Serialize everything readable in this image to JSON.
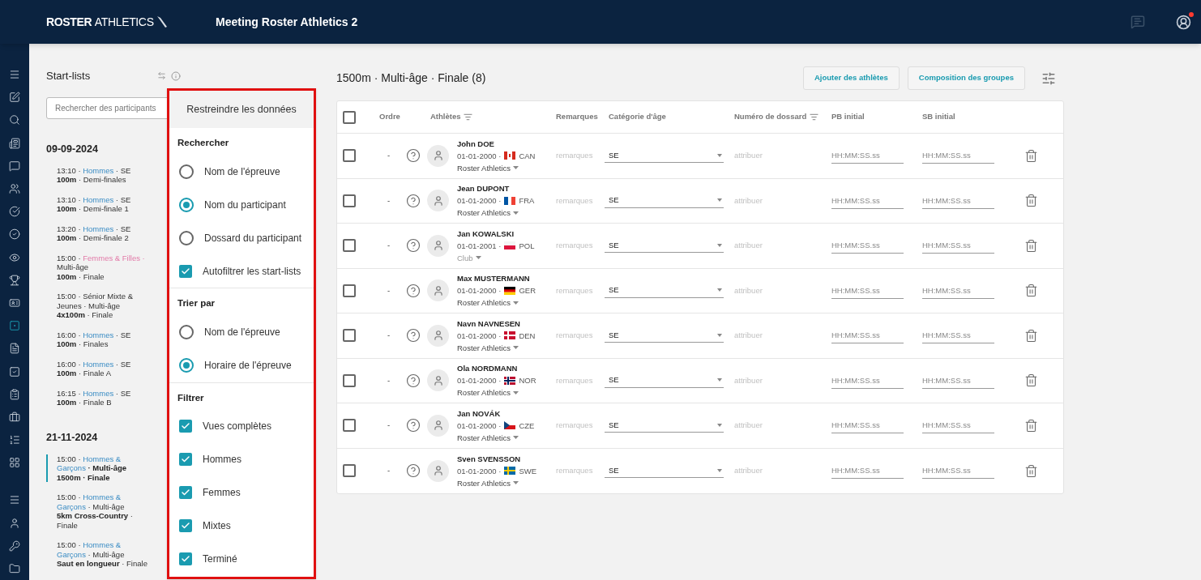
{
  "header": {
    "brand_bold": "ROSTER",
    "brand_light": "ATHLETICS",
    "title": "Meeting Roster Athletics 2",
    "notification": true
  },
  "nav_rail": [
    {
      "selected": false
    },
    {
      "selected": false
    },
    {
      "selected": false
    },
    {
      "selected": false
    },
    {
      "selected": false
    },
    {
      "selected": false
    },
    {
      "selected": false
    },
    {
      "selected": false
    },
    {
      "selected": false
    },
    {
      "selected": false
    },
    {
      "selected": false
    },
    {
      "selected": true
    },
    {
      "selected": false
    },
    {
      "selected": false
    },
    {
      "selected": false
    },
    {
      "selected": false
    },
    {
      "selected": false
    },
    {
      "selected": false
    },
    {
      "selected": false
    },
    {
      "selected": false
    },
    {
      "selected": false
    },
    {
      "selected": false
    }
  ],
  "start_lists": {
    "title": "Start-lists",
    "search": {
      "placeholder": "Rechercher des participants"
    },
    "days": [
      {
        "date": "09-09-2024",
        "events": [
          {
            "selected": false,
            "line1": [
              {
                "text": "13:10 · ",
                "kind": "plain"
              },
              {
                "text": "Hommes",
                "kind": "link"
              },
              {
                "text": " · SE",
                "kind": "plain"
              }
            ],
            "line2": [
              {
                "text": "100m",
                "kind": "bold"
              },
              {
                "text": " · Demi-finales",
                "kind": "plain"
              }
            ]
          },
          {
            "selected": false,
            "line1": [
              {
                "text": "13:10 · ",
                "kind": "plain"
              },
              {
                "text": "Hommes",
                "kind": "link"
              },
              {
                "text": " · SE",
                "kind": "plain"
              }
            ],
            "line2": [
              {
                "text": "100m",
                "kind": "bold"
              },
              {
                "text": " · Demi-finale 1",
                "kind": "plain"
              }
            ]
          },
          {
            "selected": false,
            "line1": [
              {
                "text": "13:20 · ",
                "kind": "plain"
              },
              {
                "text": "Hommes",
                "kind": "link"
              },
              {
                "text": " · SE",
                "kind": "plain"
              }
            ],
            "line2": [
              {
                "text": "100m",
                "kind": "bold"
              },
              {
                "text": " · Demi-finale 2",
                "kind": "plain"
              }
            ]
          },
          {
            "selected": false,
            "line1": [
              {
                "text": "15:00 · ",
                "kind": "plain"
              },
              {
                "text": "Femmes & Filles",
                "kind": "pink"
              },
              {
                "text": " · ",
                "kind": "pink"
              },
              {
                "text": "Multi-âge",
                "kind": "plain"
              }
            ],
            "line2": [
              {
                "text": "100m",
                "kind": "bold"
              },
              {
                "text": " · Finale",
                "kind": "plain"
              }
            ]
          },
          {
            "selected": false,
            "line1": [
              {
                "text": "15:00 · Sénior Mixte & Jeunes · Multi-âge",
                "kind": "plain"
              }
            ],
            "line2": [
              {
                "text": "4x100m",
                "kind": "bold"
              },
              {
                "text": " · Finale",
                "kind": "plain"
              }
            ]
          },
          {
            "selected": false,
            "line1": [
              {
                "text": "16:00 · ",
                "kind": "plain"
              },
              {
                "text": "Hommes",
                "kind": "link"
              },
              {
                "text": " · SE",
                "kind": "plain"
              }
            ],
            "line2": [
              {
                "text": "100m",
                "kind": "bold"
              },
              {
                "text": " · Finales",
                "kind": "plain"
              }
            ]
          },
          {
            "selected": false,
            "line1": [
              {
                "text": "16:00 · ",
                "kind": "plain"
              },
              {
                "text": "Hommes",
                "kind": "link"
              },
              {
                "text": " · SE",
                "kind": "plain"
              }
            ],
            "line2": [
              {
                "text": "100m",
                "kind": "bold"
              },
              {
                "text": " · Finale A",
                "kind": "plain"
              }
            ]
          },
          {
            "selected": false,
            "line1": [
              {
                "text": "16:15 · ",
                "kind": "plain"
              },
              {
                "text": "Hommes",
                "kind": "link"
              },
              {
                "text": " · SE",
                "kind": "plain"
              }
            ],
            "line2": [
              {
                "text": "100m",
                "kind": "bold"
              },
              {
                "text": " · Finale B",
                "kind": "plain"
              }
            ]
          }
        ]
      },
      {
        "date": "21-11-2024",
        "events": [
          {
            "selected": true,
            "line1": [
              {
                "text": "15:00 · ",
                "kind": "plain"
              },
              {
                "text": "Hommes & Garçons",
                "kind": "link"
              },
              {
                "text": " · Multi-âge",
                "kind": "strong"
              }
            ],
            "line2": [
              {
                "text": "1500m",
                "kind": "bold"
              },
              {
                "text": " · Finale",
                "kind": "bold"
              }
            ]
          },
          {
            "selected": false,
            "line1": [
              {
                "text": "15:00 · ",
                "kind": "plain"
              },
              {
                "text": "Hommes & Garçons",
                "kind": "link"
              },
              {
                "text": " · Multi-âge",
                "kind": "plain"
              }
            ],
            "line2": [
              {
                "text": "5km Cross-Country",
                "kind": "bold"
              },
              {
                "text": " · Finale",
                "kind": "plain"
              }
            ]
          },
          {
            "selected": false,
            "line1": [
              {
                "text": "15:00 · ",
                "kind": "plain"
              },
              {
                "text": "Hommes & Garçons",
                "kind": "link"
              },
              {
                "text": " · Multi-âge",
                "kind": "plain"
              }
            ],
            "line2": [
              {
                "text": "Saut en longueur",
                "kind": "bold"
              },
              {
                "text": " · Finale",
                "kind": "plain"
              }
            ]
          }
        ]
      }
    ]
  },
  "filter_popup": {
    "title": "Restreindre les données",
    "sections": [
      {
        "title": "Rechercher",
        "options": [
          {
            "kind": "radio",
            "label": "Nom de l'épreuve",
            "selected": false
          },
          {
            "kind": "radio",
            "label": "Nom du participant",
            "selected": true
          },
          {
            "kind": "radio",
            "label": "Dossard du participant",
            "selected": false
          },
          {
            "kind": "checkbox",
            "label": "Autofiltrer les start-lists",
            "checked": true
          }
        ]
      },
      {
        "title": "Trier par",
        "options": [
          {
            "kind": "radio",
            "label": "Nom de l'épreuve",
            "selected": false
          },
          {
            "kind": "radio",
            "label": "Horaire de l'épreuve",
            "selected": true
          }
        ]
      },
      {
        "title": "Filtrer",
        "options": [
          {
            "kind": "checkbox",
            "label": "Vues complètes",
            "checked": true
          },
          {
            "kind": "checkbox",
            "label": "Hommes",
            "checked": true
          },
          {
            "kind": "checkbox",
            "label": "Femmes",
            "checked": true
          },
          {
            "kind": "checkbox",
            "label": "Mixtes",
            "checked": true
          },
          {
            "kind": "checkbox",
            "label": "Terminé",
            "checked": true
          }
        ]
      }
    ]
  },
  "main": {
    "heading": "1500m · Multi-âge · Finale (8)",
    "buttons": [
      "Ajouter des athlètes",
      "Composition des groupes"
    ],
    "table": {
      "all_checked": false,
      "columns": [
        {
          "label": "Ordre",
          "filter": false
        },
        {
          "label": "Athlètes",
          "filter": true
        },
        {
          "label": "Remarques",
          "filter": false
        },
        {
          "label": "Catégorie d'âge",
          "filter": false
        },
        {
          "label": "Numéro de dossard",
          "filter": true
        },
        {
          "label": "PB initial",
          "filter": false
        },
        {
          "label": "SB initial",
          "filter": false
        }
      ],
      "rows": [
        {
          "checked": false,
          "order": "-",
          "name": "John DOE",
          "birth": "01-01-2000 ·",
          "flag": {
            "kind": "canada"
          },
          "country": "CAN",
          "club": "Roster Athletics",
          "club_muted": false,
          "remarks_placeholder": "remarques",
          "category": "SE",
          "bib_placeholder": "attribuer",
          "pb_placeholder": "HH:MM:SS.ss",
          "sb_placeholder": "HH:MM:SS.ss"
        },
        {
          "checked": false,
          "order": "-",
          "name": "Jean DUPONT",
          "birth": "01-01-2000 ·",
          "flag": {
            "kind": "france"
          },
          "country": "FRA",
          "club": "Roster Athletics",
          "club_muted": false,
          "remarks_placeholder": "remarques",
          "category": "SE",
          "bib_placeholder": "attribuer",
          "pb_placeholder": "HH:MM:SS.ss",
          "sb_placeholder": "HH:MM:SS.ss"
        },
        {
          "checked": false,
          "order": "-",
          "name": "Jan KOWALSKI",
          "birth": "01-01-2001 ·",
          "flag": {
            "kind": "poland"
          },
          "country": "POL",
          "club": "Club",
          "club_muted": true,
          "remarks_placeholder": "remarques",
          "category": "SE",
          "bib_placeholder": "attribuer",
          "pb_placeholder": "HH:MM:SS.ss",
          "sb_placeholder": "HH:MM:SS.ss"
        },
        {
          "checked": false,
          "order": "-",
          "name": "Max MUSTERMANN",
          "birth": "01-01-2000 ·",
          "flag": {
            "kind": "germany"
          },
          "country": "GER",
          "club": "Roster Athletics",
          "club_muted": false,
          "remarks_placeholder": "remarques",
          "category": "SE",
          "bib_placeholder": "attribuer",
          "pb_placeholder": "HH:MM:SS.ss",
          "sb_placeholder": "HH:MM:SS.ss"
        },
        {
          "checked": false,
          "order": "-",
          "name": "Navn NAVNESEN",
          "birth": "01-01-2000 ·",
          "flag": {
            "kind": "denmark"
          },
          "country": "DEN",
          "club": "Roster Athletics",
          "club_muted": false,
          "remarks_placeholder": "remarques",
          "category": "SE",
          "bib_placeholder": "attribuer",
          "pb_placeholder": "HH:MM:SS.ss",
          "sb_placeholder": "HH:MM:SS.ss"
        },
        {
          "checked": false,
          "order": "-",
          "name": "Ola NORDMANN",
          "birth": "01-01-2000 ·",
          "flag": {
            "kind": "norway"
          },
          "country": "NOR",
          "club": "Roster Athletics",
          "club_muted": false,
          "remarks_placeholder": "remarques",
          "category": "SE",
          "bib_placeholder": "attribuer",
          "pb_placeholder": "HH:MM:SS.ss",
          "sb_placeholder": "HH:MM:SS.ss"
        },
        {
          "checked": false,
          "order": "-",
          "name": "Jan NOVÁK",
          "birth": "01-01-2000 ·",
          "flag": {
            "kind": "czechia"
          },
          "country": "CZE",
          "club": "Roster Athletics",
          "club_muted": false,
          "remarks_placeholder": "remarques",
          "category": "SE",
          "bib_placeholder": "attribuer",
          "pb_placeholder": "HH:MM:SS.ss",
          "sb_placeholder": "HH:MM:SS.ss"
        },
        {
          "checked": false,
          "order": "-",
          "name": "Sven SVENSSON",
          "birth": "01-01-2000 ·",
          "flag": {
            "kind": "sweden"
          },
          "country": "SWE",
          "club": "Roster Athletics",
          "club_muted": false,
          "remarks_placeholder": "remarques",
          "category": "SE",
          "bib_placeholder": "attribuer",
          "pb_placeholder": "HH:MM:SS.ss",
          "sb_placeholder": "HH:MM:SS.ss"
        }
      ]
    }
  }
}
